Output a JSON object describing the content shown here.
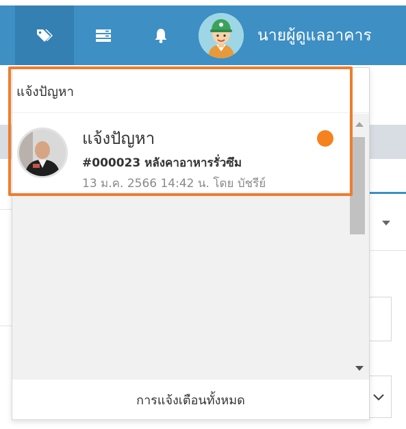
{
  "navbar": {
    "user_name": "นายผู้ดูแลอาคาร",
    "icons": [
      "tags-icon",
      "server-list-icon",
      "bell-icon"
    ]
  },
  "dropdown": {
    "header_title": "แจ้งปัญหา",
    "items": [
      {
        "title": "แจ้งปัญหา",
        "subtitle": "#000023 หลังคาอาหารรั่วซึม",
        "meta": "13 ม.ค. 2566 14:42 น. โดย บัชรีย์",
        "unread": true
      }
    ],
    "footer_label": "การแจ้งเตือนทั้งหมด"
  },
  "colors": {
    "navbar": "#3d8fc4",
    "navbar_active": "#3480b2",
    "unread_dot": "#f5821f",
    "highlight": "#ee7d2c"
  }
}
